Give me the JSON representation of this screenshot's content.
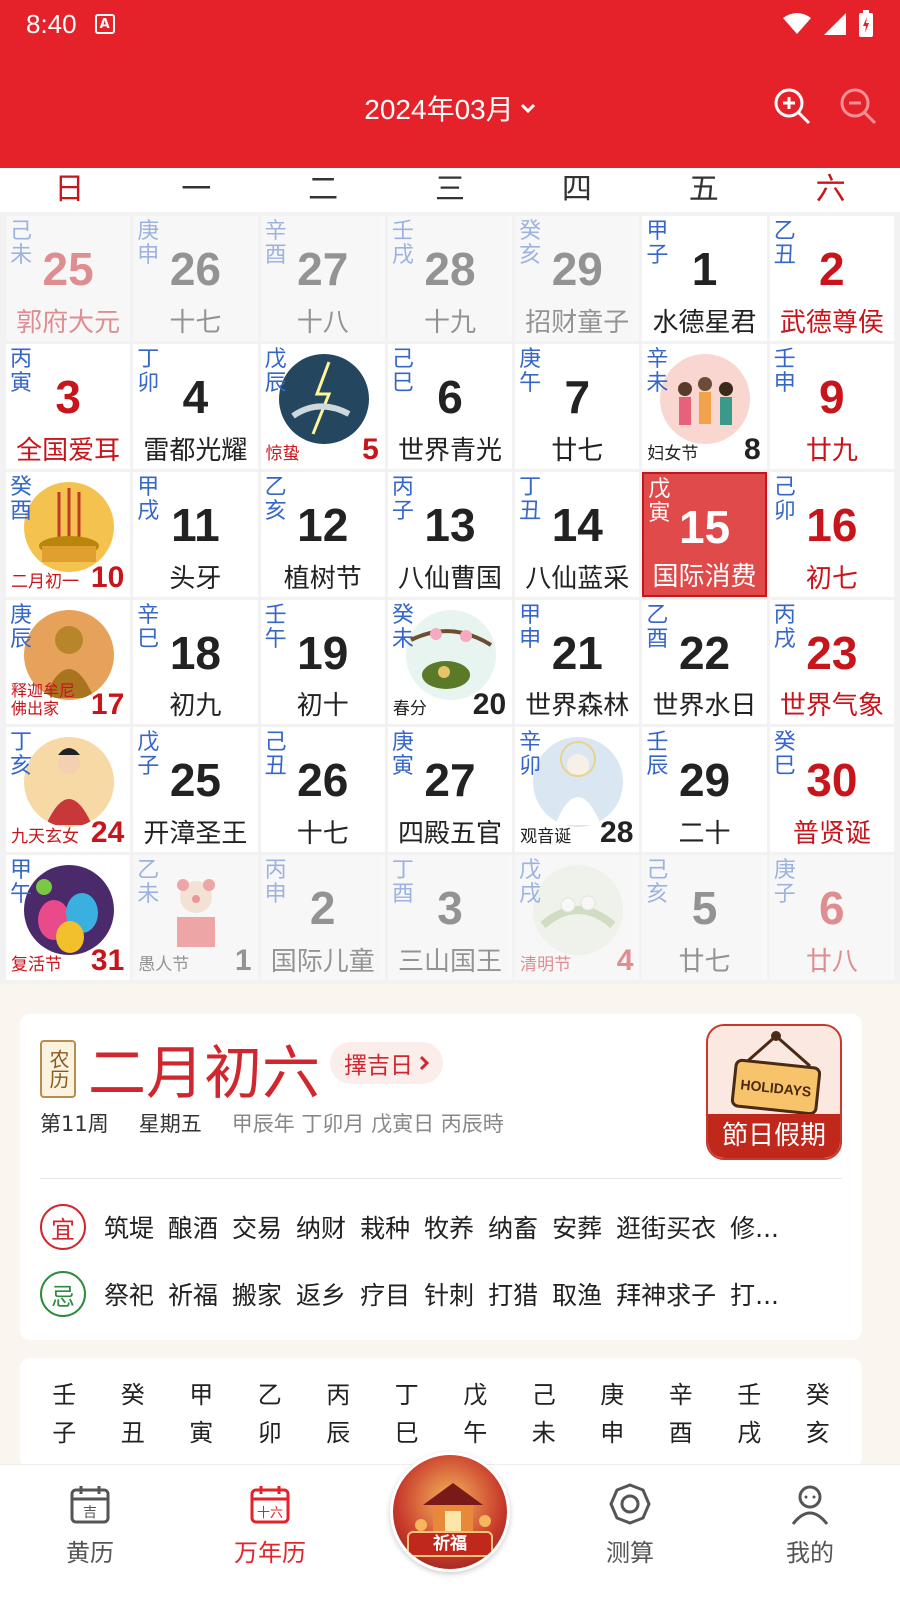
{
  "status": {
    "time": "8:40",
    "app_icon": "A"
  },
  "header": {
    "month_title": "2024年03月"
  },
  "weekdays": [
    "日",
    "一",
    "二",
    "三",
    "四",
    "五",
    "六"
  ],
  "days": [
    {
      "gz": "己未",
      "num": "25",
      "sub": "郭府大元",
      "faded": true,
      "red": true
    },
    {
      "gz": "庚申",
      "num": "26",
      "sub": "十七",
      "faded": true
    },
    {
      "gz": "辛酉",
      "num": "27",
      "sub": "十八",
      "faded": true
    },
    {
      "gz": "壬戌",
      "num": "28",
      "sub": "十九",
      "faded": true
    },
    {
      "gz": "癸亥",
      "num": "29",
      "sub": "招财童子",
      "faded": true
    },
    {
      "gz": "甲子",
      "num": "1",
      "sub": "水德星君"
    },
    {
      "gz": "乙丑",
      "num": "2",
      "sub": "武德尊侯",
      "red": true
    },
    {
      "gz": "丙寅",
      "num": "3",
      "sub": "全国爱耳",
      "red": true
    },
    {
      "gz": "丁卯",
      "num": "4",
      "sub": "雷都光耀"
    },
    {
      "gz": "戊辰",
      "num": "5",
      "pic": "storm",
      "label": "惊蛰",
      "labelred": true
    },
    {
      "gz": "己巳",
      "num": "6",
      "sub": "世界青光"
    },
    {
      "gz": "庚午",
      "num": "7",
      "sub": "廿七"
    },
    {
      "gz": "辛未",
      "num": "8",
      "pic": "women",
      "label": "妇女节"
    },
    {
      "gz": "壬申",
      "num": "9",
      "sub": "廿九",
      "red": true
    },
    {
      "gz": "癸酉",
      "num": "10",
      "pic": "incense",
      "label": "二月初一",
      "red": true
    },
    {
      "gz": "甲戌",
      "num": "11",
      "sub": "头牙"
    },
    {
      "gz": "乙亥",
      "num": "12",
      "sub": "植树节"
    },
    {
      "gz": "丙子",
      "num": "13",
      "sub": "八仙曹国"
    },
    {
      "gz": "丁丑",
      "num": "14",
      "sub": "八仙蓝采"
    },
    {
      "gz": "戊寅",
      "num": "15",
      "sub": "国际消费",
      "today": true
    },
    {
      "gz": "己卯",
      "num": "16",
      "sub": "初七",
      "red": true
    },
    {
      "gz": "庚辰",
      "num": "17",
      "pic": "buddha",
      "label": "释迦牟尼佛出家",
      "red": true
    },
    {
      "gz": "辛巳",
      "num": "18",
      "sub": "初九"
    },
    {
      "gz": "壬午",
      "num": "19",
      "sub": "初十"
    },
    {
      "gz": "癸未",
      "num": "20",
      "pic": "spring",
      "label": "春分"
    },
    {
      "gz": "甲申",
      "num": "21",
      "sub": "世界森林"
    },
    {
      "gz": "乙酉",
      "num": "22",
      "sub": "世界水日"
    },
    {
      "gz": "丙戌",
      "num": "23",
      "sub": "世界气象",
      "red": true
    },
    {
      "gz": "丁亥",
      "num": "24",
      "pic": "goddess",
      "label": "九天玄女",
      "red": true
    },
    {
      "gz": "戊子",
      "num": "25",
      "sub": "开漳圣王"
    },
    {
      "gz": "己丑",
      "num": "26",
      "sub": "十七"
    },
    {
      "gz": "庚寅",
      "num": "27",
      "sub": "四殿五官"
    },
    {
      "gz": "辛卯",
      "num": "28",
      "pic": "guanyin",
      "label": "观音诞"
    },
    {
      "gz": "壬辰",
      "num": "29",
      "sub": "二十"
    },
    {
      "gz": "癸巳",
      "num": "30",
      "sub": "普贤诞",
      "red": true
    },
    {
      "gz": "甲午",
      "num": "31",
      "pic": "easter",
      "label": "复活节",
      "red": true
    },
    {
      "gz": "乙未",
      "num": "1",
      "pic": "clown",
      "label": "愚人节",
      "faded": true
    },
    {
      "gz": "丙申",
      "num": "2",
      "sub": "国际儿童",
      "faded": true
    },
    {
      "gz": "丁酉",
      "num": "3",
      "sub": "三山国王",
      "faded": true
    },
    {
      "gz": "戊戌",
      "num": "4",
      "pic": "qingming",
      "label": "清明节",
      "faded": true,
      "red": true
    },
    {
      "gz": "己亥",
      "num": "5",
      "sub": "廿七",
      "faded": true
    },
    {
      "gz": "庚子",
      "num": "6",
      "sub": "廿八",
      "faded": true,
      "red": true
    }
  ],
  "lunar": {
    "badge": "农历",
    "date": "二月初六",
    "zeji": "擇吉日",
    "week": "第11周",
    "weekday": "星期五",
    "ganzhi": "甲辰年 丁卯月 戊寅日 丙辰時",
    "holiday_sign": "HOLIDAYS",
    "holiday_banner": "節日假期",
    "yi_badge": "宜",
    "yi": [
      "筑堤",
      "酿酒",
      "交易",
      "纳财",
      "栽种",
      "牧养",
      "纳畜",
      "安葬",
      "逛街买衣",
      "修..."
    ],
    "ji_badge": "忌",
    "ji": [
      "祭祀",
      "祈福",
      "搬家",
      "返乡",
      "疗目",
      "针刺",
      "打猎",
      "取渔",
      "拜神求子",
      "打..."
    ],
    "colors": {
      "yi": "#d0262d",
      "ji": "#2d8a3e"
    }
  },
  "ganzhi_strip": [
    [
      "壬",
      "子"
    ],
    [
      "癸",
      "丑"
    ],
    [
      "甲",
      "寅"
    ],
    [
      "乙",
      "卯"
    ],
    [
      "丙",
      "辰"
    ],
    [
      "丁",
      "巳"
    ],
    [
      "戊",
      "午"
    ],
    [
      "己",
      "未"
    ],
    [
      "庚",
      "申"
    ],
    [
      "辛",
      "酉"
    ],
    [
      "壬",
      "戌"
    ],
    [
      "癸",
      "亥"
    ]
  ],
  "tabs": [
    {
      "label": "黄历",
      "icon": "almanac-icon"
    },
    {
      "label": "万年历",
      "icon": "calendar-icon",
      "active": true
    },
    {
      "label": "祈福",
      "icon": "qifu-icon"
    },
    {
      "label": "测算",
      "icon": "bagua-icon"
    },
    {
      "label": "我的",
      "icon": "user-icon"
    }
  ],
  "theme": {
    "primary": "#e5222a",
    "lunar_blue": "#3566c9",
    "holiday_red": "#c8151b"
  }
}
